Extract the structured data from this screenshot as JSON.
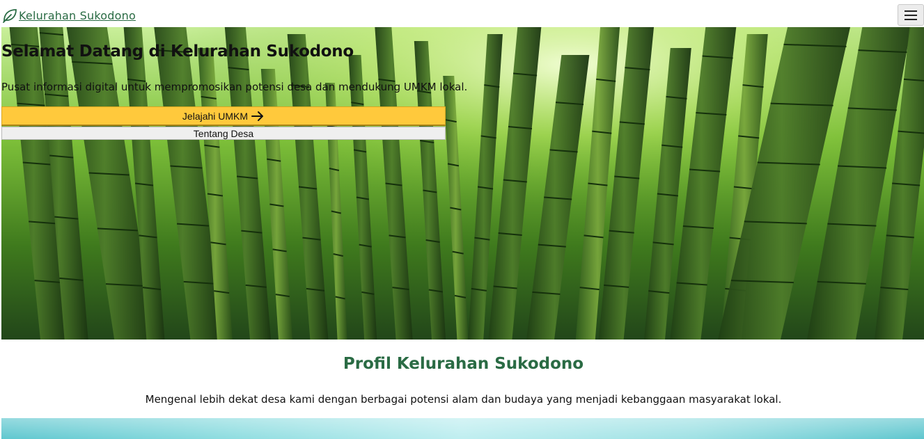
{
  "navbar": {
    "brand_label": "Kelurahan Sukodono",
    "brand_icon": "leaf-icon",
    "menu_icon": "hamburger-menu-icon"
  },
  "hero": {
    "title": "Selamat Datang di Kelurahan Sukodono",
    "subtitle": "Pusat informasi digital untuk mempromosikan potensi desa dan mendukung UMKM lokal.",
    "primary_button": "Jelajahi UMKM",
    "primary_button_icon": "arrow-right-icon",
    "secondary_button": "Tentang Desa",
    "background": "bamboo-forest-image"
  },
  "profile": {
    "title": "Profil Kelurahan Sukodono",
    "description": "Mengenal lebih dekat desa kami dengan berbagai potensi alam dan budaya yang menjadi kebanggaan masyarakat lokal."
  },
  "colors": {
    "brand_green": "#2a6b44",
    "accent_yellow": "#ffc93c",
    "secondary_button_bg": "#efefef"
  }
}
